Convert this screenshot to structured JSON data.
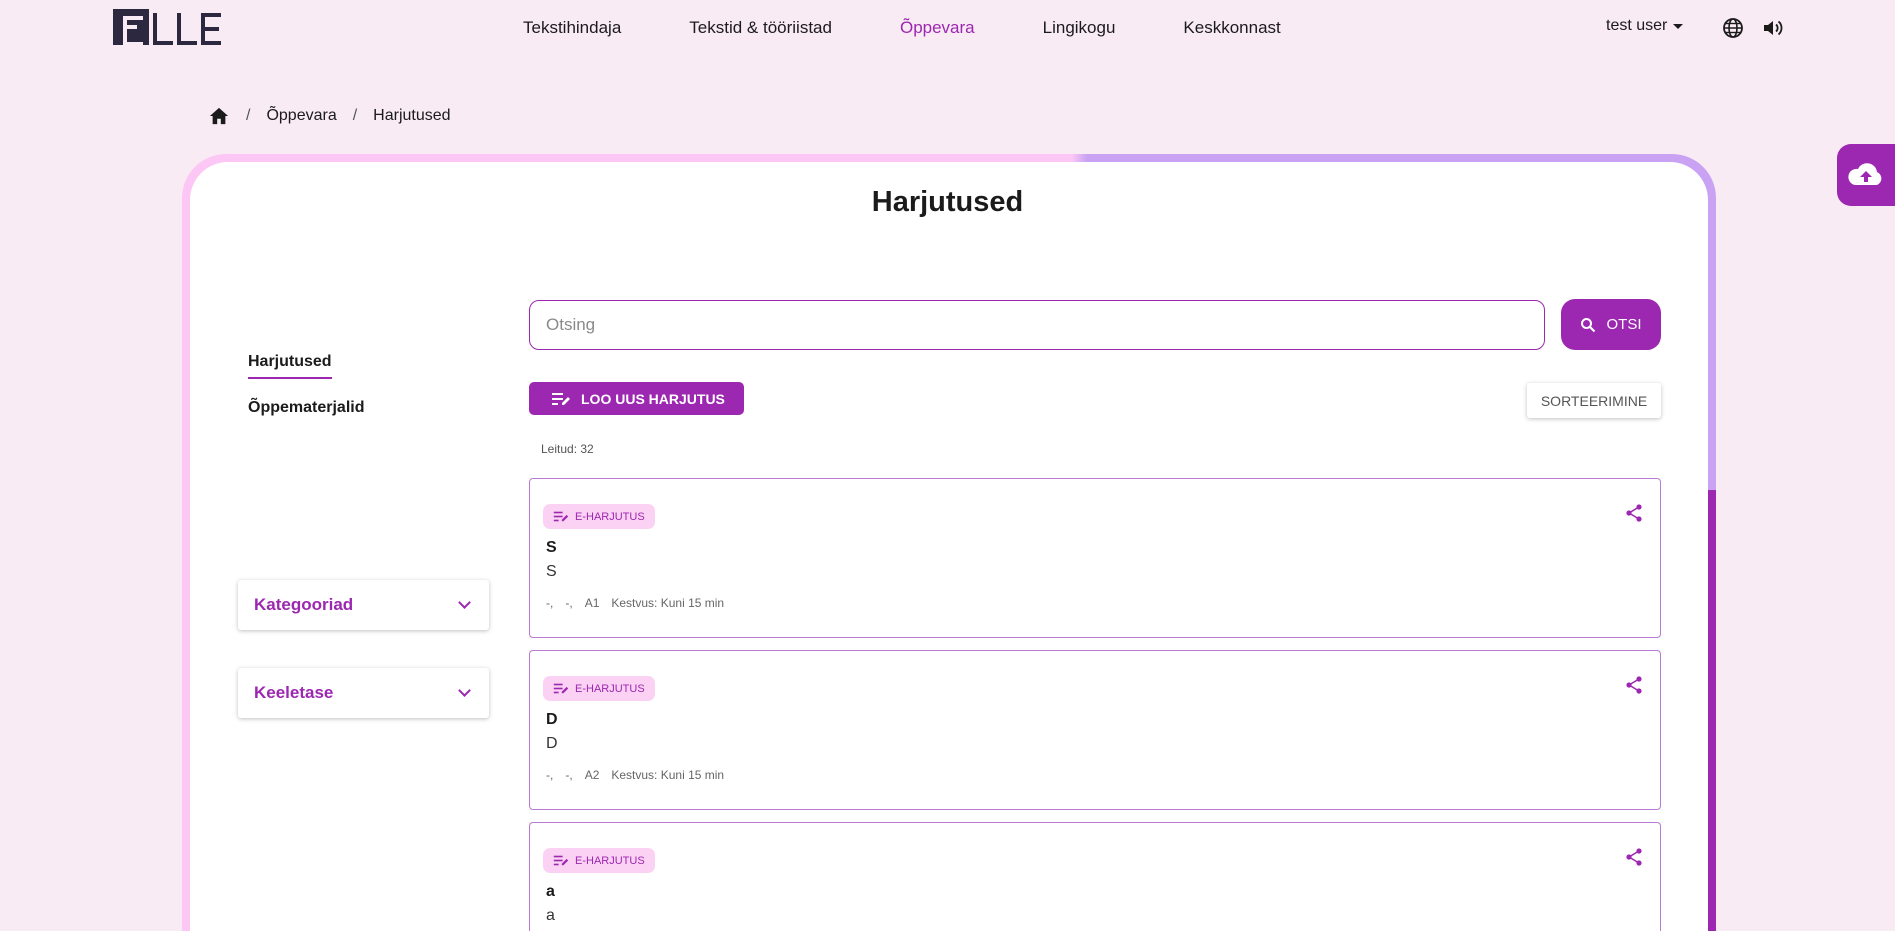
{
  "nav": {
    "items": [
      {
        "label": "Tekstihindaja",
        "active": false
      },
      {
        "label": "Tekstid & tööriistad",
        "active": false
      },
      {
        "label": "Õppevara",
        "active": true
      },
      {
        "label": "Lingikogu",
        "active": false
      },
      {
        "label": "Keskkonnast",
        "active": false
      }
    ],
    "user": "test user",
    "icons": {
      "language": "globe-icon",
      "audio": "speaker-icon"
    }
  },
  "breadcrumb": {
    "home_icon": "home-icon",
    "items": [
      "Õppevara",
      "Harjutused"
    ]
  },
  "page": {
    "title": "Harjutused"
  },
  "sidebar": {
    "tabs": [
      {
        "label": "Harjutused",
        "active": true
      },
      {
        "label": "Õppematerjalid",
        "active": false
      }
    ],
    "filters": [
      {
        "label": "Kategooriad"
      },
      {
        "label": "Keeletase"
      }
    ]
  },
  "search": {
    "placeholder": "Otsing",
    "value": "",
    "button_label": "OTSI"
  },
  "toolbar": {
    "create_label": "LOO UUS HARJUTUS",
    "sort_label": "SORTEERIMINE"
  },
  "results": {
    "found_text": "Leitud: 32",
    "items": [
      {
        "badge": "E-HARJUTUS",
        "title": "S",
        "subtitle": "S",
        "meta": [
          "-,",
          "-,",
          "A1",
          "Kestvus: Kuni 15 min"
        ]
      },
      {
        "badge": "E-HARJUTUS",
        "title": "D",
        "subtitle": "D",
        "meta": [
          "-,",
          "-,",
          "A2",
          "Kestvus: Kuni 15 min"
        ]
      },
      {
        "badge": "E-HARJUTUS",
        "title": "a",
        "subtitle": "a",
        "meta": []
      }
    ]
  },
  "colors": {
    "accent": "#9c27b0",
    "background": "#f9ebf4",
    "badge_bg": "#fbd2f3"
  },
  "upload": {
    "icon": "cloud-upload-icon"
  }
}
